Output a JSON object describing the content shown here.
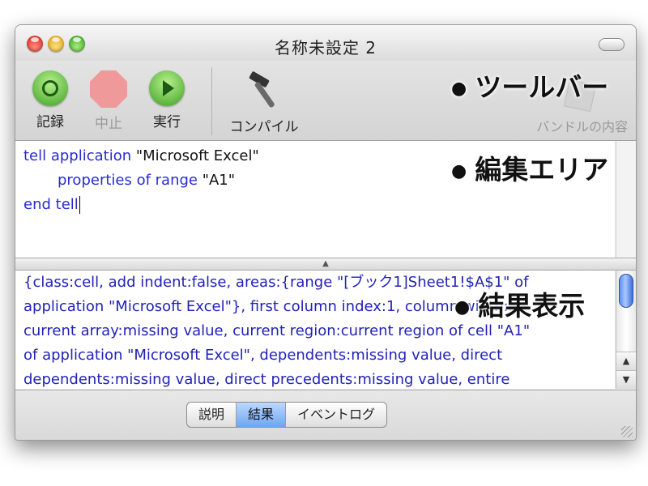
{
  "window": {
    "title": "名称未設定 2"
  },
  "toolbar": {
    "record": "記録",
    "stop": "中止",
    "run": "実行",
    "compile": "コンパイル",
    "bundle": "バンドルの内容"
  },
  "annotations": {
    "toolbar": "ツールバー",
    "editor": "編集エリア",
    "result": "結果表示"
  },
  "editor": {
    "line1_kw": "tell application ",
    "line1_str": "\"Microsoft Excel\"",
    "line2_kw": "properties of range ",
    "line2_str": "\"A1\"",
    "line3_kw": "end tell"
  },
  "result": {
    "lines": [
      "{class:cell, add indent:false, areas:{range \"[ブック1]Sheet1!$A$1\" of",
      "application \"Microsoft Excel\"}, first column index:1, column width:...",
      "current array:missing value, current region:current region of cell \"A1\"",
      "of application \"Microsoft Excel\", dependents:missing value, direct",
      "dependents:missing value, direct precedents:missing value, entire"
    ]
  },
  "tabs": [
    "説明",
    "結果",
    "イベントログ"
  ],
  "colors": {
    "keyword": "#2a2ad2",
    "selected_tab": "#6ea6f0"
  }
}
